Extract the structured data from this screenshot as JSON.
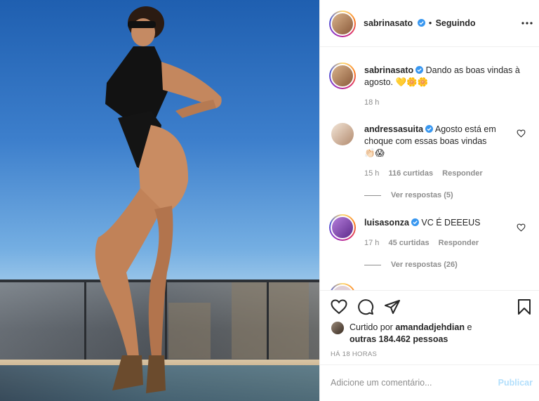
{
  "post": {
    "username": "sabrinasato",
    "follow_status": "Seguindo",
    "caption": "Dando as boas vindas à agosto.",
    "caption_emojis": "💛🌼🌼",
    "caption_time": "18 h"
  },
  "comments": [
    {
      "username": "andressasuita",
      "text": "Agosto está em choque com essas boas vindas",
      "emojis": "👏🏻😱",
      "time": "15 h",
      "likes": "116 curtidas",
      "reply": "Responder",
      "view_replies": "Ver respostas (5)"
    },
    {
      "username": "luisasonza",
      "text": "VC É DEEEUS",
      "time": "17 h",
      "likes": "45 curtidas",
      "reply": "Responder",
      "view_replies": "Ver respostas (26)"
    }
  ],
  "likes_line": {
    "prefix": "Curtido por",
    "user": "amandadjehdian",
    "suffix": "e",
    "others": "outras 184.462 pessoas"
  },
  "timestamp": "HÁ 18 HORAS",
  "add_comment": {
    "placeholder": "Adicione um comentário...",
    "publish": "Publicar"
  },
  "colors": {
    "verified": "#3897f0",
    "publish_disabled": "#b2dffc",
    "muted": "#8e8e8e"
  }
}
